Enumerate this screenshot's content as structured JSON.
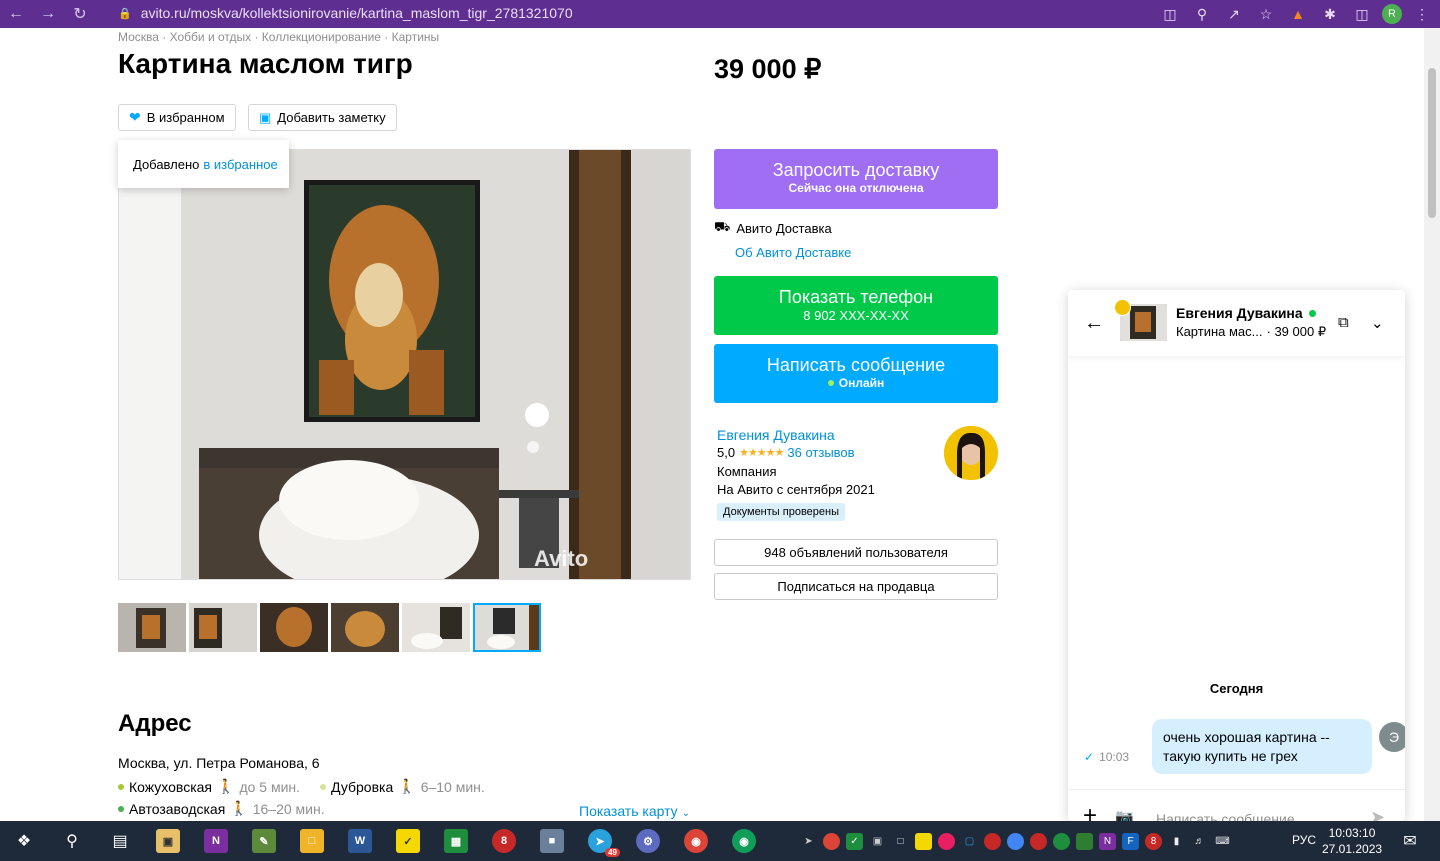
{
  "browser": {
    "url": "avito.ru/moskva/kollektsionirovanie/kartina_maslom_tigr_2781321070",
    "profile_initial": "R"
  },
  "breadcrumb": "Москва · Хобби и отдых · Коллекционирование · Картины",
  "listing": {
    "title": "Картина маслом тигр",
    "price": "39 000 ₽",
    "favorite_label": "В избранном",
    "add_note_label": "Добавить заметку",
    "tooltip_text": "Добавлено",
    "tooltip_link": "в избранное",
    "watermark": "Avito"
  },
  "actions": {
    "delivery_main": "Запросить доставку",
    "delivery_sub": "Сейчас она отключена",
    "avito_delivery": "Авито Доставка",
    "about_delivery": "Об Авито Доставке",
    "phone_main": "Показать телефон",
    "phone_sub": "8 902 XXX-XX-XX",
    "message_main": "Написать сообщение",
    "message_sub": "Онлайн"
  },
  "seller": {
    "name": "Евгения Дувакина",
    "rating": "5,0",
    "reviews": "36 отзывов",
    "type": "Компания",
    "since": "На Авито с сентября 2021",
    "docs": "Документы проверены",
    "listings_btn": "948 объявлений пользователя",
    "subscribe_btn": "Подписаться на продавца"
  },
  "address": {
    "title": "Адрес",
    "line": "Москва, ул. Петра Романова, 6",
    "metro": [
      {
        "name": "Кожуховская",
        "time": "до 5 мин.",
        "color": "#a6c83c"
      },
      {
        "name": "Дубровка",
        "time": "6–10 мин.",
        "color": "#a6c83c"
      },
      {
        "name": "Автозаводская",
        "time": "16–20 мин.",
        "color": "#4caf50"
      }
    ],
    "show_map": "Показать карту"
  },
  "chat": {
    "name": "Евгения Дувакина",
    "item": "Картина мас...",
    "price": "· 39 000 ₽",
    "day": "Сегодня",
    "message": "очень хорошая картина -- такую купить не грех",
    "time": "10:03",
    "user_initial": "Э",
    "input_placeholder": "Написать сообщение"
  },
  "taskbar": {
    "lang": "РУС",
    "time": "10:03:10",
    "date": "27.01.2023",
    "telegram_badge": "49"
  },
  "colors": {
    "delivery": "#9f6ef2",
    "phone": "#00c94a",
    "message": "#00aaff",
    "link": "#0091d6"
  }
}
